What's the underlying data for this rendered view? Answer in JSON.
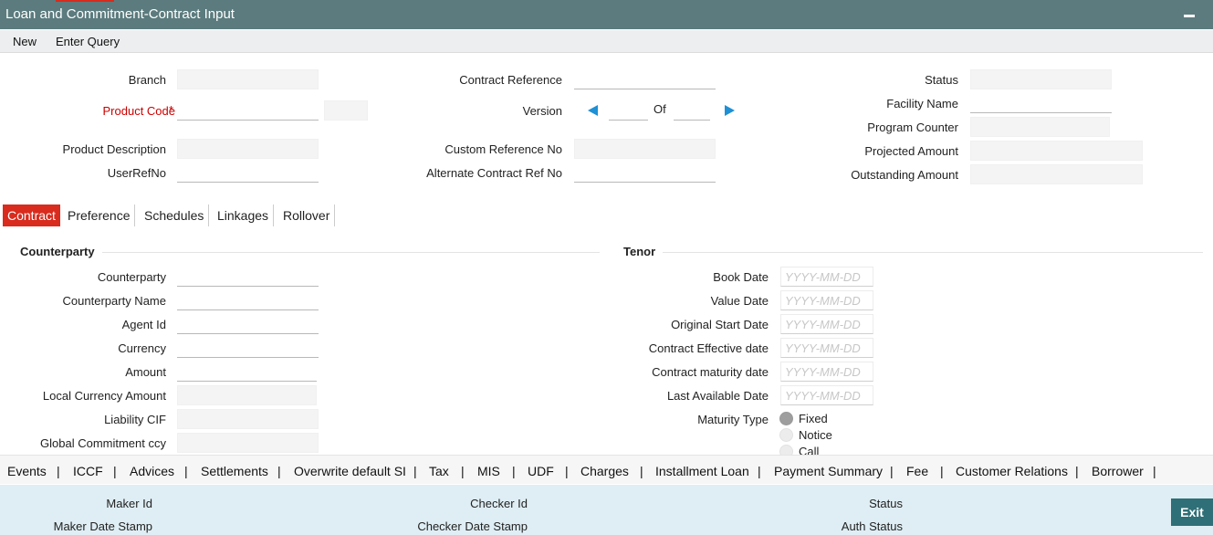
{
  "window": {
    "title": "Loan and Commitment-Contract Input"
  },
  "toolbar": {
    "new_label": "New",
    "enter_query_label": "Enter Query"
  },
  "header": {
    "branch_label": "Branch",
    "product_code_label": "Product Code",
    "required_mark": "*",
    "product_description_label": "Product Description",
    "user_ref_no_label": "UserRefNo",
    "contract_reference_label": "Contract Reference",
    "version_label": "Version",
    "of_label": "Of",
    "custom_reference_label": "Custom Reference No",
    "alternate_contract_ref_label": "Alternate Contract Ref No",
    "status_label": "Status",
    "facility_name_label": "Facility Name",
    "program_counter_label": "Program Counter",
    "projected_amount_label": "Projected Amount",
    "outstanding_amount_label": "Outstanding Amount"
  },
  "tabs": [
    "Contract",
    "Preference",
    "Schedules",
    "Linkages",
    "Rollover"
  ],
  "counterparty": {
    "title": "Counterparty",
    "counterparty_label": "Counterparty",
    "counterparty_name_label": "Counterparty Name",
    "agent_id_label": "Agent Id",
    "currency_label": "Currency",
    "amount_label": "Amount",
    "local_currency_amount_label": "Local Currency Amount",
    "liability_cif_label": "Liability CIF",
    "global_commitment_ccy_label": "Global Commitment ccy"
  },
  "tenor": {
    "title": "Tenor",
    "date_placeholder": "YYYY-MM-DD",
    "book_date_label": "Book Date",
    "value_date_label": "Value Date",
    "original_start_date_label": "Original Start Date",
    "contract_effective_date_label": "Contract Effective date",
    "contract_maturity_date_label": "Contract maturity date",
    "last_available_date_label": "Last Available Date",
    "maturity_type_label": "Maturity Type",
    "maturity_options": [
      "Fixed",
      "Notice",
      "Call"
    ],
    "maturity_selected": "Fixed"
  },
  "subsystems": [
    "Events",
    "ICCF",
    "Advices",
    "Settlements",
    "Overwrite default SI",
    "Tax",
    "MIS",
    "UDF",
    "Charges",
    "Installment Loan",
    "Payment Summary",
    "Fee",
    "Customer Relations",
    "Borrower"
  ],
  "subsystem_separator": "|",
  "audit": {
    "maker_id_label": "Maker Id",
    "maker_date_stamp_label": "Maker Date Stamp",
    "checker_id_label": "Checker Id",
    "checker_date_stamp_label": "Checker Date Stamp",
    "status_label": "Status",
    "auth_status_label": "Auth Status"
  },
  "exit_label": "Exit",
  "colors": {
    "titlebar": "#5b7b7e",
    "accent": "#d92b1e",
    "audit_bg": "#dfeef4",
    "exit_button": "#2f6f77",
    "arrow": "#1e90d6"
  }
}
